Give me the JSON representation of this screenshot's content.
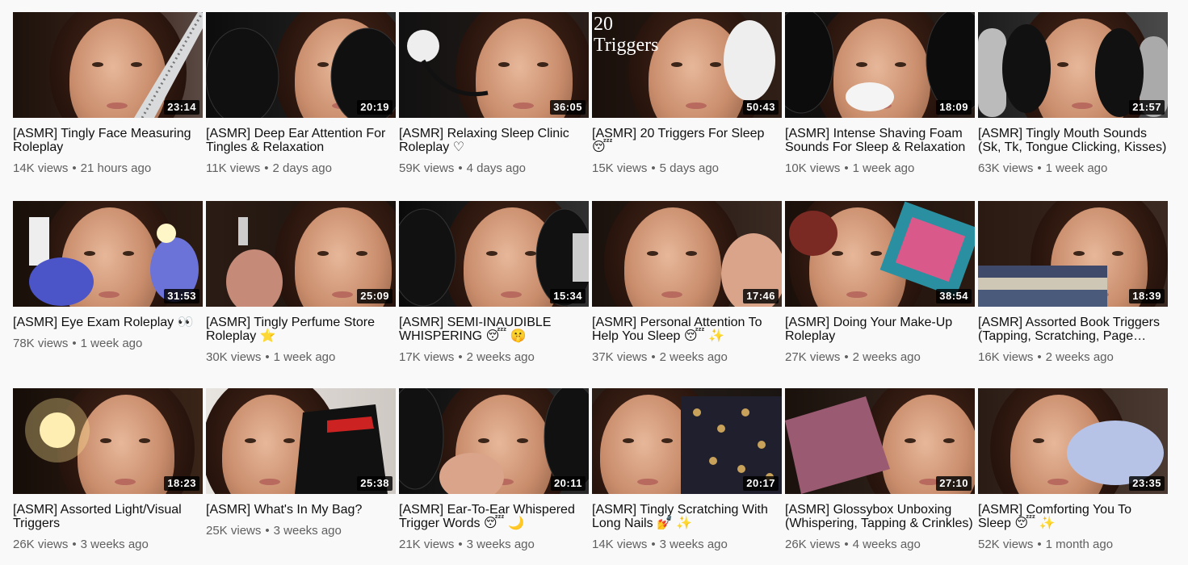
{
  "videos": [
    {
      "title": "[ASMR] Tingly Face Measuring Roleplay",
      "duration": "23:14",
      "views": "14K views",
      "age": "21 hours ago"
    },
    {
      "title": "[ASMR] Deep Ear Attention For Tingles & Relaxation",
      "duration": "20:19",
      "views": "11K views",
      "age": "2 days ago"
    },
    {
      "title": "[ASMR] Relaxing Sleep Clinic Roleplay ♡",
      "duration": "36:05",
      "views": "59K views",
      "age": "4 days ago"
    },
    {
      "title": "[ASMR] 20 Triggers For Sleep 😴",
      "duration": "50:43",
      "views": "15K views",
      "age": "5 days ago",
      "overlay": "20\nTriggers"
    },
    {
      "title": "[ASMR] Intense Shaving Foam Sounds For Sleep & Relaxation",
      "duration": "18:09",
      "views": "10K views",
      "age": "1 week ago"
    },
    {
      "title": "[ASMR] Tingly Mouth Sounds (Sk, Tk, Tongue Clicking, Kisses)",
      "duration": "21:57",
      "views": "63K views",
      "age": "1 week ago"
    },
    {
      "title": "[ASMR] Eye Exam Roleplay 👀",
      "duration": "31:53",
      "views": "78K views",
      "age": "1 week ago"
    },
    {
      "title": "[ASMR] Tingly Perfume Store Roleplay ⭐",
      "duration": "25:09",
      "views": "30K views",
      "age": "1 week ago"
    },
    {
      "title": "[ASMR] SEMI-INAUDIBLE WHISPERING 😴 🤫",
      "duration": "15:34",
      "views": "17K views",
      "age": "2 weeks ago"
    },
    {
      "title": "[ASMR] Personal Attention To Help You Sleep 😴 ✨",
      "duration": "17:46",
      "views": "37K views",
      "age": "2 weeks ago"
    },
    {
      "title": "[ASMR] Doing Your Make-Up Roleplay",
      "duration": "38:54",
      "views": "27K views",
      "age": "2 weeks ago"
    },
    {
      "title": "[ASMR] Assorted Book Triggers (Tapping, Scratching, Page Turning)",
      "duration": "18:39",
      "views": "16K views",
      "age": "2 weeks ago"
    },
    {
      "title": "[ASMR] Assorted Light/Visual Triggers",
      "duration": "18:23",
      "views": "26K views",
      "age": "3 weeks ago"
    },
    {
      "title": "[ASMR] What's In My Bag?",
      "duration": "25:38",
      "views": "25K views",
      "age": "3 weeks ago"
    },
    {
      "title": "[ASMR] Ear-To-Ear Whispered Trigger Words 😴 🌙",
      "duration": "20:11",
      "views": "21K views",
      "age": "3 weeks ago"
    },
    {
      "title": "[ASMR] Tingly Scratching With Long Nails 💅 ✨",
      "duration": "20:17",
      "views": "14K views",
      "age": "3 weeks ago"
    },
    {
      "title": "[ASMR] Glossybox Unboxing (Whispering, Tapping & Crinkles)",
      "duration": "27:10",
      "views": "26K views",
      "age": "4 weeks ago"
    },
    {
      "title": "[ASMR] Comforting You To Sleep 😴 ✨",
      "duration": "23:35",
      "views": "52K views",
      "age": "1 month ago"
    }
  ],
  "colors": {
    "page_bg": "#f9f9f9",
    "title": "#0f0f0f",
    "meta": "#606060",
    "duration_bg": "#000000"
  }
}
